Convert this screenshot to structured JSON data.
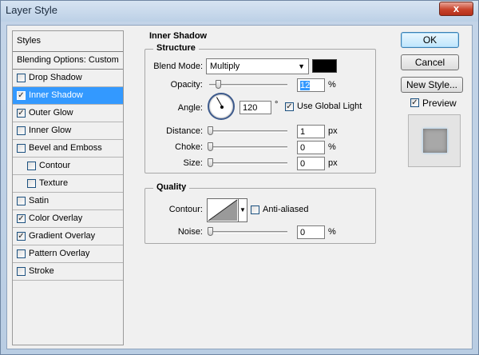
{
  "window": {
    "title": "Layer Style",
    "close_glyph": "x"
  },
  "styles_list": {
    "header": "Styles",
    "blending_options": "Blending Options: Custom",
    "items": [
      {
        "label": "Drop Shadow",
        "checked": false,
        "sub": false
      },
      {
        "label": "Inner Shadow",
        "checked": true,
        "sub": false,
        "selected": true
      },
      {
        "label": "Outer Glow",
        "checked": true,
        "sub": false
      },
      {
        "label": "Inner Glow",
        "checked": false,
        "sub": false
      },
      {
        "label": "Bevel and Emboss",
        "checked": false,
        "sub": false
      },
      {
        "label": "Contour",
        "checked": false,
        "sub": true
      },
      {
        "label": "Texture",
        "checked": false,
        "sub": true
      },
      {
        "label": "Satin",
        "checked": false,
        "sub": false
      },
      {
        "label": "Color Overlay",
        "checked": true,
        "sub": false
      },
      {
        "label": "Gradient Overlay",
        "checked": true,
        "sub": false
      },
      {
        "label": "Pattern Overlay",
        "checked": false,
        "sub": false
      },
      {
        "label": "Stroke",
        "checked": false,
        "sub": false
      }
    ]
  },
  "inner_shadow": {
    "title": "Inner Shadow",
    "structure": {
      "title": "Structure",
      "blend_mode_label": "Blend Mode:",
      "blend_mode_value": "Multiply",
      "shadow_color": "#000000",
      "opacity_label": "Opacity:",
      "opacity_value": "12",
      "opacity_unit": "%",
      "angle_label": "Angle:",
      "angle_value": "120",
      "angle_unit": "°",
      "use_global_light_label": "Use Global Light",
      "use_global_light": true,
      "distance_label": "Distance:",
      "distance_value": "1",
      "distance_unit": "px",
      "choke_label": "Choke:",
      "choke_value": "0",
      "choke_unit": "%",
      "size_label": "Size:",
      "size_value": "0",
      "size_unit": "px"
    },
    "quality": {
      "title": "Quality",
      "contour_label": "Contour:",
      "anti_aliased_label": "Anti-aliased",
      "anti_aliased": false,
      "noise_label": "Noise:",
      "noise_value": "0",
      "noise_unit": "%"
    }
  },
  "buttons": {
    "ok": "OK",
    "cancel": "Cancel",
    "new_style": "New Style...",
    "preview_label": "Preview",
    "preview_checked": true
  }
}
